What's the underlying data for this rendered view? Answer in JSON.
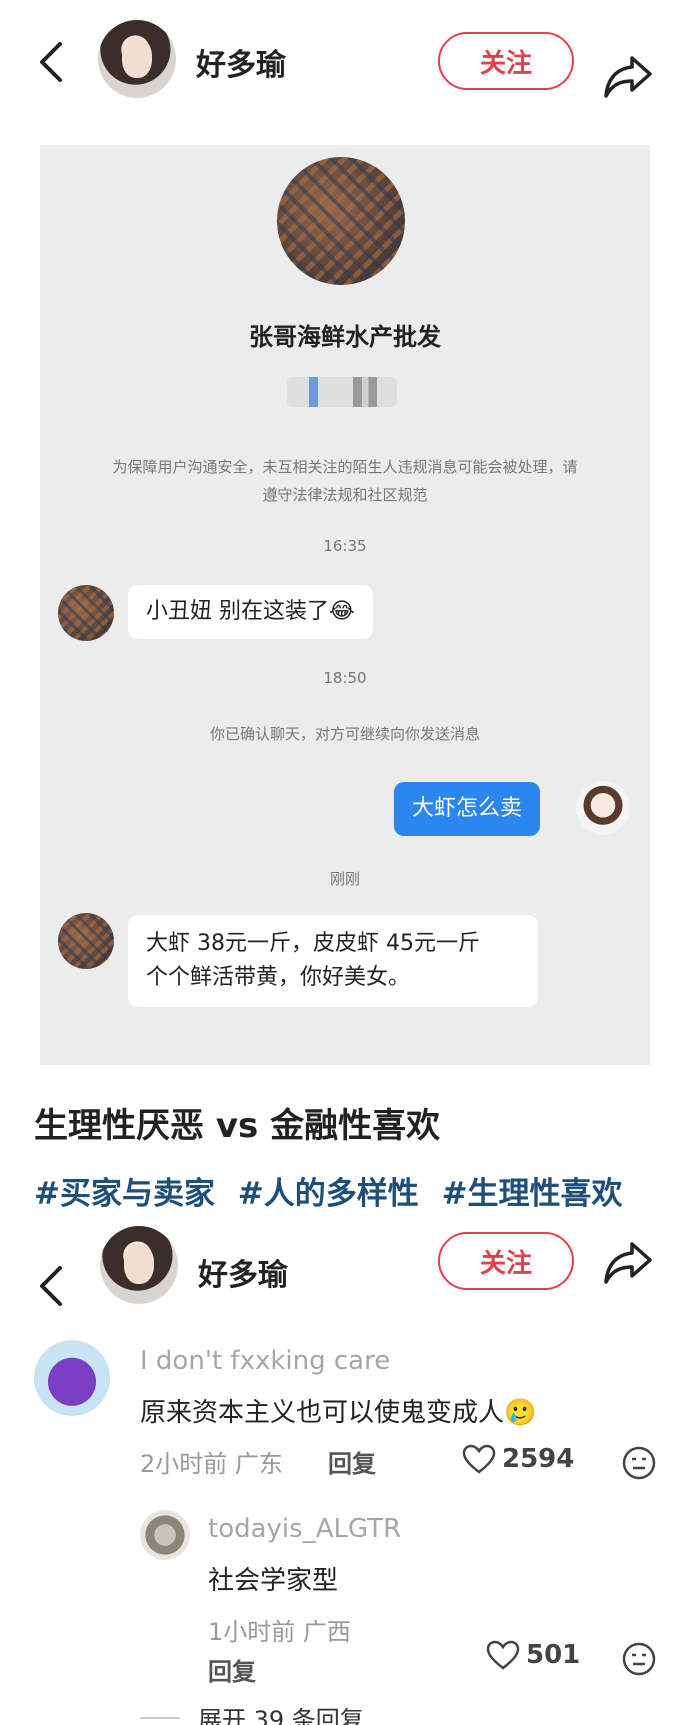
{
  "header": {
    "name": "好多瑜",
    "follow_label": "关注"
  },
  "chat": {
    "shop_name": "张哥海鲜水产批发",
    "notice": "为保障用户沟通安全，未互相关注的陌生人违规消息可能会被处理，请遵守法律法规和社区规范",
    "time1": "16:35",
    "msg1": "小丑妞 别在这装了😂",
    "time2": "18:50",
    "system_msg": "你已确认聊天，对方可继续向你发送消息",
    "my_msg": "大虾怎么卖",
    "time3": "刚刚",
    "msg3_line1": "大虾 38元一斤，皮皮虾 45元一斤",
    "msg3_line2": "个个鲜活带黄，你好美女。"
  },
  "post": {
    "title": "生理性厌恶 vs 金融性喜欢",
    "tags": [
      "#买家与卖家",
      "#人的多样性",
      "#生理性喜欢"
    ]
  },
  "header2": {
    "name": "好多瑜",
    "follow_label": "关注"
  },
  "comments": [
    {
      "user": "I don't fxxking care",
      "text": "原来资本主义也可以使鬼变成人🥲",
      "time_loc": "2小时前 广东",
      "reply_label": "回复",
      "likes": "2594"
    },
    {
      "user": "todayis_ALGTR",
      "text": "社会学家型",
      "time_loc": "1小时前 广西",
      "reply_label": "回复",
      "likes": "501"
    }
  ],
  "expand_label": "展开 39 条回复"
}
